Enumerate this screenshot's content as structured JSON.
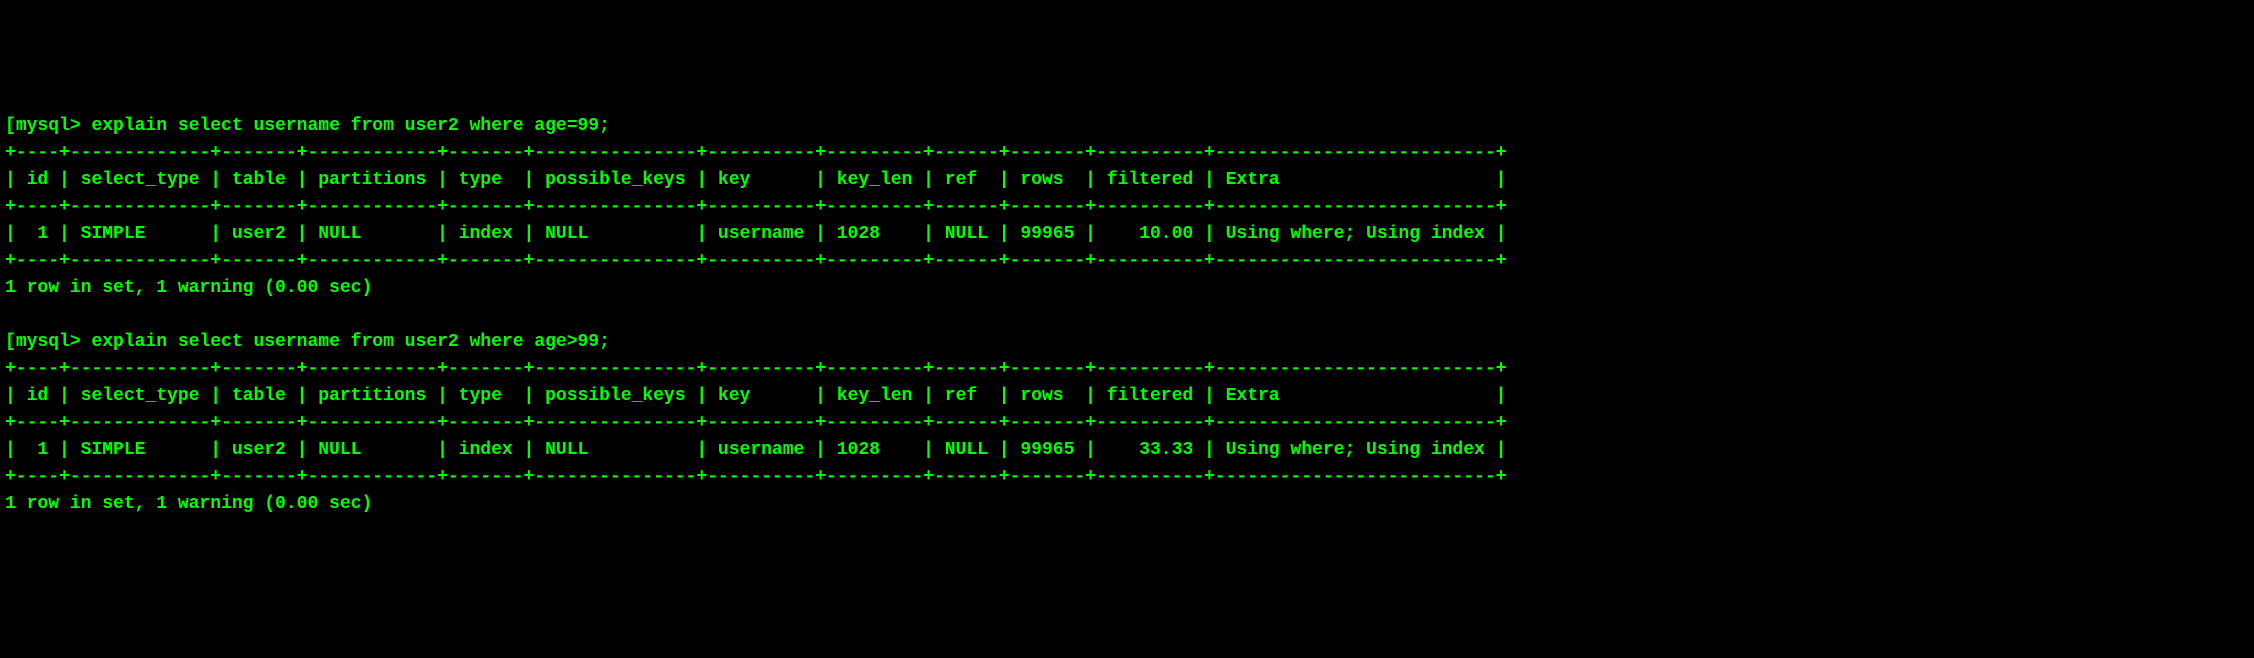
{
  "queries": [
    {
      "prompt_open": "[",
      "prompt": "mysql>",
      "command": " explain select username from user2 where age=99;",
      "table_border_top": "+----+-------------+-------+------------+-------+---------------+----------+---------+------+-------+----------+--------------------------+",
      "table_header": "| id | select_type | table | partitions | type  | possible_keys | key      | key_len | ref  | rows  | filtered | Extra                    |",
      "table_border_mid": "+----+-------------+-------+------------+-------+---------------+----------+---------+------+-------+----------+--------------------------+",
      "table_row": "|  1 | SIMPLE      | user2 | NULL       | index | NULL          | username | 1028    | NULL | 99965 |    10.00 | Using where; Using index |",
      "table_border_bottom": "+----+-------------+-------+------------+-------+---------------+----------+---------+------+-------+----------+--------------------------+",
      "result_summary": "1 row in set, 1 warning (0.00 sec)"
    },
    {
      "prompt_open": "[",
      "prompt": "mysql>",
      "command": " explain select username from user2 where age>99;",
      "table_border_top": "+----+-------------+-------+------------+-------+---------------+----------+---------+------+-------+----------+--------------------------+",
      "table_header": "| id | select_type | table | partitions | type  | possible_keys | key      | key_len | ref  | rows  | filtered | Extra                    |",
      "table_border_mid": "+----+-------------+-------+------------+-------+---------------+----------+---------+------+-------+----------+--------------------------+",
      "table_row": "|  1 | SIMPLE      | user2 | NULL       | index | NULL          | username | 1028    | NULL | 99965 |    33.33 | Using where; Using index |",
      "table_border_bottom": "+----+-------------+-------+------------+-------+---------------+----------+---------+------+-------+----------+--------------------------+",
      "result_summary": "1 row in set, 1 warning (0.00 sec)"
    }
  ]
}
